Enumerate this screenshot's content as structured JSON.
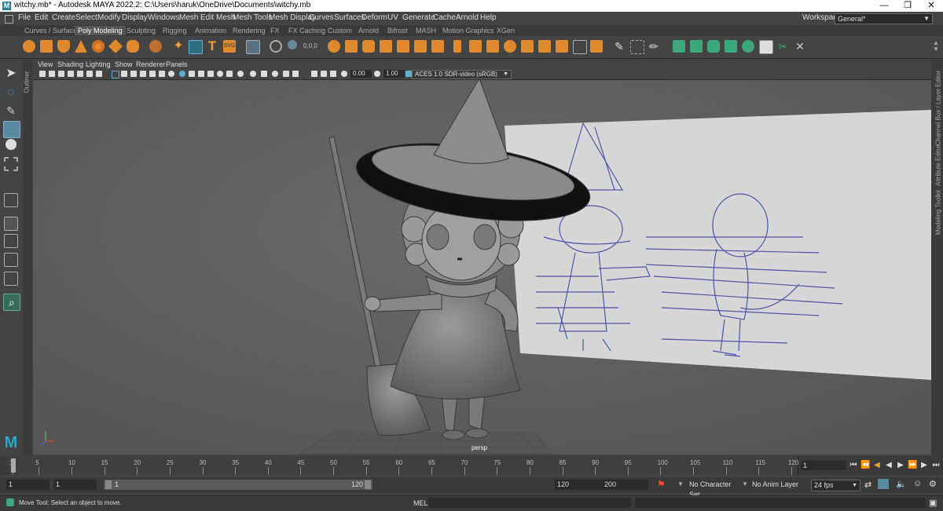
{
  "window": {
    "title": "witchy.mb* - Autodesk MAYA 2022.2: C:\\Users\\haruk\\OneDrive\\Documents\\witchy.mb",
    "minimize": "—",
    "maximize": "❐",
    "close": "✕"
  },
  "menus": [
    "File",
    "Edit",
    "Create",
    "Select",
    "Modify",
    "Display",
    "Windows",
    "Mesh",
    "Edit Mesh",
    "Mesh Tools",
    "Mesh Display",
    "Curves",
    "Surfaces",
    "Deform",
    "UV",
    "Generate",
    "Cache",
    "Arnold",
    "Help"
  ],
  "workspace": {
    "label": "Workspace:",
    "value": "General*"
  },
  "shelf_tabs": [
    "Curves / Surfaces",
    "Poly Modeling",
    "Sculpting",
    "Rigging",
    "Animation",
    "Rendering",
    "FX",
    "FX Caching",
    "Custom",
    "Arnold",
    "Bifrost",
    "MASH",
    "Motion Graphics",
    "XGen"
  ],
  "active_shelf_tab": "Poly Modeling",
  "panel_menu": [
    "View",
    "Shading",
    "Lighting",
    "Show",
    "Renderer",
    "Panels"
  ],
  "panel_toolbar": {
    "exposure": "0.00",
    "gamma": "1.00",
    "color_space": "ACES 1.0 SDR-video (sRGB)"
  },
  "outliner_label": "Outliner",
  "right_panels": [
    "Channel Box / Layer Editor",
    "Attribute Editor",
    "Modeling Toolkit"
  ],
  "viewport": {
    "camera_label": "persp"
  },
  "timeline": {
    "ticks": [
      "1",
      "5",
      "10",
      "15",
      "20",
      "25",
      "30",
      "35",
      "40",
      "45",
      "50",
      "55",
      "60",
      "65",
      "70",
      "75",
      "80",
      "85",
      "90",
      "95",
      "100",
      "105",
      "110",
      "115",
      "120"
    ],
    "tick_frames": [
      1,
      5,
      10,
      15,
      20,
      25,
      30,
      35,
      40,
      45,
      50,
      55,
      60,
      65,
      70,
      75,
      80,
      85,
      90,
      95,
      100,
      105,
      110,
      115,
      120
    ],
    "current_frame": "1"
  },
  "range": {
    "start": "1",
    "playback_start": "1",
    "slider_start": "1",
    "slider_end": "120",
    "playback_end": "120",
    "end": "200",
    "character_set": "No Character Set",
    "anim_layer": "No Anim Layer",
    "fps": "24 fps"
  },
  "status": {
    "message": "Move Tool: Select an object to move.",
    "mel_label": "MEL"
  },
  "colors": {
    "accent_orange": "#f0a030",
    "highlight_teal": "#5bb0d0",
    "sketch_blue": "#3c3ca0",
    "shelf_green": "#3aa87a"
  }
}
